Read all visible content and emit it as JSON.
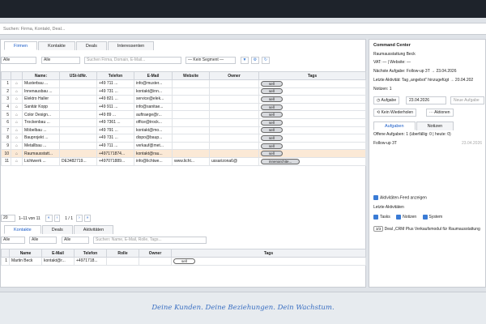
{
  "search": {
    "placeholder": "Suchen: Firma, Kontakt, Deal..."
  },
  "main_tabs": [
    "Firmen",
    "Kontakte",
    "Deals",
    "Interessenten"
  ],
  "filters": {
    "a": "Alle",
    "b": "Alle",
    "search_placeholder": "Suchen Firma, Domain, E-Mail...",
    "segment": "— Kein Segment —"
  },
  "company_table": {
    "headers": [
      "",
      "",
      "Name:",
      "USt-IdNr.",
      "Telefon",
      "E-Mail",
      "Website",
      "Owner",
      "Tags"
    ],
    "rows": [
      {
        "n": "1",
        "name": "Musterbau ...",
        "ust": "",
        "tel": "+49 711 ...",
        "mail": "info@muster...",
        "web": "",
        "owner": "",
        "tag": "sell"
      },
      {
        "n": "2",
        "name": "Innenausbau ...",
        "ust": "",
        "tel": "+49 731 ...",
        "mail": "kontakt@inn...",
        "web": "",
        "owner": "",
        "tag": "sell"
      },
      {
        "n": "3",
        "name": "Elektro Haller",
        "ust": "",
        "tel": "+49 821 ...",
        "mail": "service@elek...",
        "web": "",
        "owner": "",
        "tag": "sell"
      },
      {
        "n": "4",
        "name": "Sanitär Kopp",
        "ust": "",
        "tel": "+49 911 ...",
        "mail": "info@sanitae...",
        "web": "",
        "owner": "",
        "tag": "sell"
      },
      {
        "n": "5",
        "name": "Color Design...",
        "ust": "",
        "tel": "+49 89 ...",
        "mail": "auftraege@r...",
        "web": "",
        "owner": "",
        "tag": "sell"
      },
      {
        "n": "6",
        "name": "Trockenbau ...",
        "ust": "",
        "tel": "+49 7361 ...",
        "mail": "office@trock...",
        "web": "",
        "owner": "",
        "tag": "sell"
      },
      {
        "n": "7",
        "name": "Möbelbau ...",
        "ust": "",
        "tel": "+49 791 ...",
        "mail": "kontakt@mo...",
        "web": "",
        "owner": "",
        "tag": "sell"
      },
      {
        "n": "8",
        "name": "Bauprojekt ...",
        "ust": "",
        "tel": "+49 731 ...",
        "mail": "dispo@baup...",
        "web": "",
        "owner": "",
        "tag": "sell"
      },
      {
        "n": "9",
        "name": "Metallbau ...",
        "ust": "",
        "tel": "+49 711 ...",
        "mail": "verkauf@met...",
        "web": "",
        "owner": "",
        "tag": "sell"
      },
      {
        "n": "10",
        "name": "Raumausstatt...",
        "ust": "",
        "tel": "+497171874...",
        "mail": "kontakt@rau...",
        "web": "",
        "owner": "",
        "tag": "sell"
      },
      {
        "n": "11",
        "name": "Lichtwerk ...",
        "ust": "DE3482719...",
        "tel": "+497071889...",
        "mail": "info@lichtwe...",
        "web": "www.licht...",
        "owner": "ussarizona6@",
        "tag": "innenarchite..."
      }
    ]
  },
  "pager": {
    "page_size": "20",
    "range": "1–11 von 11",
    "first": "«",
    "prev": "‹",
    "page": "1 / 1",
    "next": "›",
    "last": "»"
  },
  "sub_tabs": [
    "Kontakte",
    "Deals",
    "Aktivitäten"
  ],
  "sub_filters": {
    "a": "Alle",
    "b": "Alle",
    "search_placeholder": "Suchen: Name, E-Mail, Rolle, Tags..."
  },
  "contact_table": {
    "headers": [
      "",
      "Name",
      "E-Mail",
      "Telefon",
      "Rolle",
      "Owner",
      "Tags"
    ],
    "rows": [
      {
        "n": "1",
        "name": "Martin Beck",
        "mail": "kontakt@r...",
        "tel": "+4971718...",
        "rolle": "",
        "owner": "",
        "tag": "sell"
      }
    ]
  },
  "command_center": {
    "title": "Command Center",
    "company": "Raumausstattung Beck",
    "vat": "VAT: — | Website: —",
    "next_task": "Nächste Aufgabe: Follow-up 3T → 23.04.2026",
    "last_activity": "Letzte Aktivität: Tag „angebot\" hinzugefügt → 20.04.202",
    "notes_count": "Notizen: 1",
    "btn_task": "Aufgabe",
    "date_value": "23.04.2026",
    "next_ph": "Neue Aufgabe",
    "btn_no_repeat": "Kein Wiederholen",
    "btn_actions": "··· Aktionen",
    "tabs": [
      "Aufgaben",
      "Notizen"
    ],
    "open_tasks": "Offene Aufgaben: 1 (überfällig: 0 | heute: 0)",
    "task_name": "Follow-up 3T",
    "task_date": "23.04.2026",
    "feed_toggle": "Aktivitäten-Feed anzeigen",
    "last_activities_label": "Letzte Aktivitäten",
    "checks": [
      "Tasks",
      "Notizen",
      "System"
    ],
    "deal_badge": "3/3",
    "deal_text": "Deal „CRM Plus Verkaufsmodul für Raumausstattung"
  },
  "footer": {
    "tagline": "Deine Kunden. Deine Beziehungen. Dein Wachstum."
  },
  "colors": {
    "accent": "#1a5cc8",
    "selected_row": "#fbe9d6",
    "topbar": "#1e232b",
    "tagline": "#3a6fc2"
  }
}
